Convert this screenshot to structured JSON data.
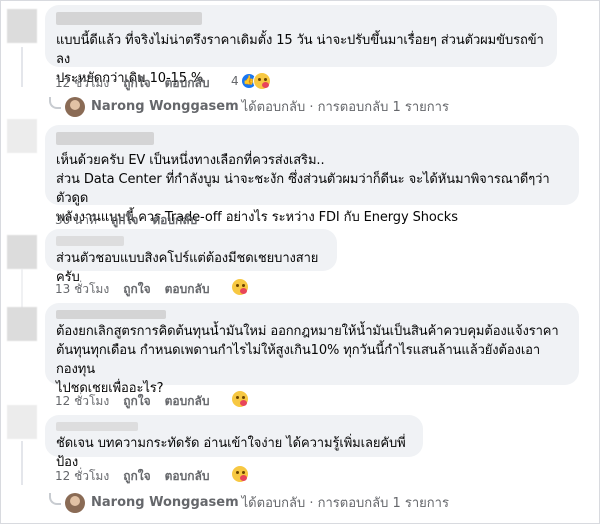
{
  "comments": [
    {
      "text": "แบบนี้ดีแล้ว ที่จริงไม่น่าตรึงราคาเดิมตั้ง 15 วัน น่าจะปรับขึ้นมาเรื่อยๆ ส่วนตัวผมขับรถข้าลง\nประหยัดกว่าเดิม 10-15 %",
      "time": "12 ชั่วโมง",
      "like_label": "ถูกใจ",
      "reply_label": "ตอบกลับ",
      "reaction_count": "4"
    },
    {
      "text": "เห็นด้วยครับ EV เป็นหนึ่งทางเลือกที่ควรส่งเสริม..\nส่วน Data Center ที่กำลังบูม น่าจะชะงัก ซึ่งส่วนตัวผมว่าก็ดีนะ จะได้หันมาพิจารณาดีๆว่า ตัวดูด\nพลังงานแบบนี้ ควร Trade-off อย่างไร ระหว่าง FDI กับ Energy Shocks",
      "time": "30 นาที",
      "like_label": "ถูกใจ",
      "reply_label": "ตอบกลับ"
    },
    {
      "text": "ส่วนตัวชอบแบบสิงคโปร์แต่ต้องมีชดเชยบางสายครับ",
      "time": "13 ชั่วโมง",
      "like_label": "ถูกใจ",
      "reply_label": "ตอบกลับ"
    },
    {
      "text": "ต้องยกเลิกสูตรการคิดต้นทุนน้ำมันใหม่ ออกกฎหมายให้น้ำมันเป็นสินค้าควบคุมต้องแจ้งราคา\nต้นทุนทุกเดือน กำหนดเพดานกำไรไม่ให้สูงเกิน10% ทุกวันนี้กำไรแสนล้านแล้วยังต้องเอากองทุน\nไปชดเชยเพื่ออะไร?",
      "time": "12 ชั่วโมง",
      "like_label": "ถูกใจ",
      "reply_label": "ตอบกลับ"
    },
    {
      "text": "ชัดเจน บทความกระทัดรัด อ่านเข้าใจง่าย ได้ความรู้เพิ่มเลยคับพี่ป้อง",
      "time": "12 ชั่วโมง",
      "like_label": "ถูกใจ",
      "reply_label": "ตอบกลับ"
    }
  ],
  "replies": [
    {
      "name": "Narong Wonggasem",
      "rest": "ได้ตอบกลับ · การตอบกลับ 1 รายการ"
    },
    {
      "name": "Narong Wonggasem",
      "rest": "ได้ตอบกลับ · การตอบกลับ 1 รายการ"
    }
  ],
  "colors": {
    "bubble": "#f0f2f5",
    "meta_text": "#65676b",
    "like_blue": "#1877f2"
  }
}
